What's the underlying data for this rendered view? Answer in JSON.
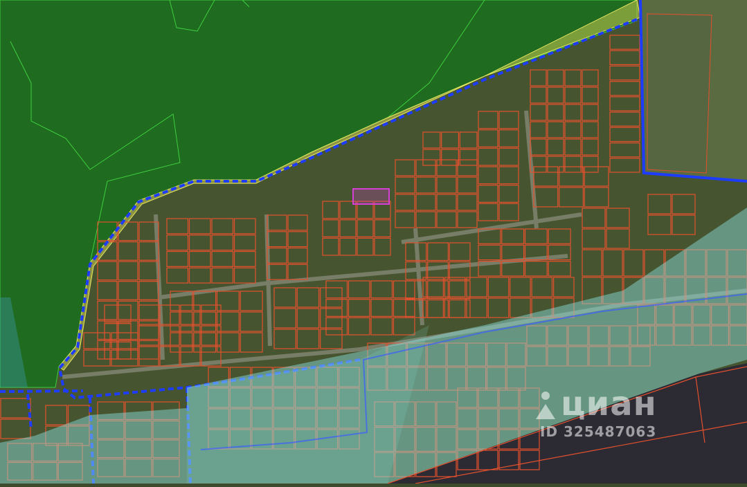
{
  "map": {
    "colors": {
      "forest_zone": "#1f6b1f",
      "forest_border": "#3fcf3f",
      "settlement_bg": "#4a5a36",
      "parcel_border": "#e4502e",
      "selected_parcel": "#d63fd6",
      "settlement_boundary": "#1e3cff",
      "buffer_strip": "#c8c850",
      "water_protection_zone": "#8fe6e6",
      "field": "#5b6b40",
      "road": "#9a9a8a",
      "dark_zone": "#2a2a30"
    },
    "layers": [
      "forest-zone",
      "settlement-boundary",
      "cadastral-parcels",
      "selected-parcel",
      "water-protection-zone"
    ]
  },
  "watermark": {
    "brand": "циан",
    "listing_id": "ID 325487063"
  }
}
